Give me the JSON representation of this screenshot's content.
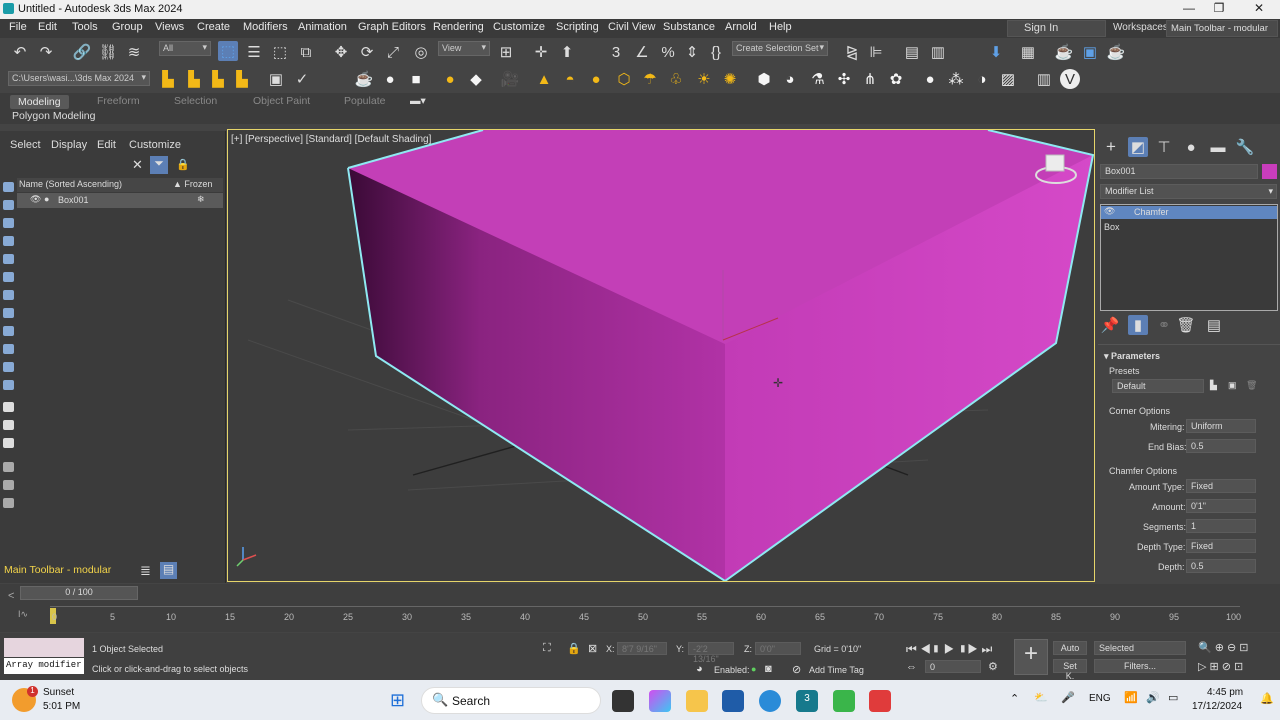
{
  "window": {
    "title": "Untitled - Autodesk 3ds Max 2024"
  },
  "menu": [
    "File",
    "Edit",
    "Tools",
    "Group",
    "Views",
    "Create",
    "Modifiers",
    "Animation",
    "Graph Editors",
    "Rendering",
    "Customize",
    "Scripting",
    "Civil View",
    "Substance",
    "Arnold",
    "Help"
  ],
  "signin": "Sign In",
  "workspaces": {
    "label": "Workspaces:",
    "value": "Main Toolbar - modular"
  },
  "toolbar": {
    "filter_value": "All",
    "refcoord_value": "View",
    "selection_set_value": "Create Selection Set",
    "project_path": "C:\\Users\\wasi...\\3ds Max 2024"
  },
  "ribbon": {
    "tabs": [
      "Modeling",
      "Freeform",
      "Selection",
      "Object Paint",
      "Populate"
    ],
    "sub": "Polygon Modeling"
  },
  "explorer": {
    "menu": [
      "Select",
      "Display",
      "Edit",
      "Customize"
    ],
    "column_name": "Name (Sorted Ascending)",
    "column_frozen": "▲ Frozen",
    "row_name": "Box001",
    "toolbar_label": "Main Toolbar - modular"
  },
  "viewport": {
    "label": "[+] [Perspective] [Standard] [Default Shading]",
    "object_color": "#c93dbc"
  },
  "cmdpanel": {
    "object_name": "Box001",
    "modifier_list": "Modifier List",
    "stack": [
      "Chamfer",
      "Box"
    ],
    "rollout": "Parameters",
    "presets_label": "Presets",
    "presets_value": "Default",
    "corner_options": "Corner Options",
    "mitering_label": "Mitering:",
    "mitering_value": "Uniform",
    "end_bias_label": "End Bias:",
    "end_bias_value": "0.5",
    "chamfer_options": "Chamfer Options",
    "amount_type_label": "Amount Type:",
    "amount_type_value": "Fixed",
    "amount_label": "Amount:",
    "amount_value": "0'1\"",
    "segments_label": "Segments:",
    "segments_value": "1",
    "depth_type_label": "Depth Type:",
    "depth_type_value": "Fixed",
    "depth_label": "Depth:",
    "depth_value": "0.5"
  },
  "timeline": {
    "slider": "0 / 100",
    "ticks": [
      "0",
      "5",
      "10",
      "15",
      "20",
      "25",
      "30",
      "35",
      "40",
      "45",
      "50",
      "55",
      "60",
      "65",
      "70",
      "75",
      "80",
      "85",
      "90",
      "95",
      "100"
    ]
  },
  "status": {
    "listener": "Array modifier",
    "objects_selected": "1 Object Selected",
    "prompt": "Click or click-and-drag to select objects",
    "x_label": "X:",
    "x_value": "8'7 9/16\"",
    "y_label": "Y:",
    "y_value": "-2'2 13/16\"",
    "z_label": "Z:",
    "z_value": "0'0\"",
    "grid": "Grid = 0'10\"",
    "enabled": "Enabled:",
    "add_time_tag": "Add Time Tag",
    "auto": "Auto",
    "set_key": "Set K.",
    "selected": "Selected",
    "filters": "Filters...",
    "frame": "0"
  },
  "taskbar": {
    "weather_title": "Sunset",
    "weather_time": "5:01 PM",
    "search": "Search",
    "lang": "ENG",
    "time": "4:45 pm",
    "date": "17/12/2024",
    "badge": "1"
  }
}
